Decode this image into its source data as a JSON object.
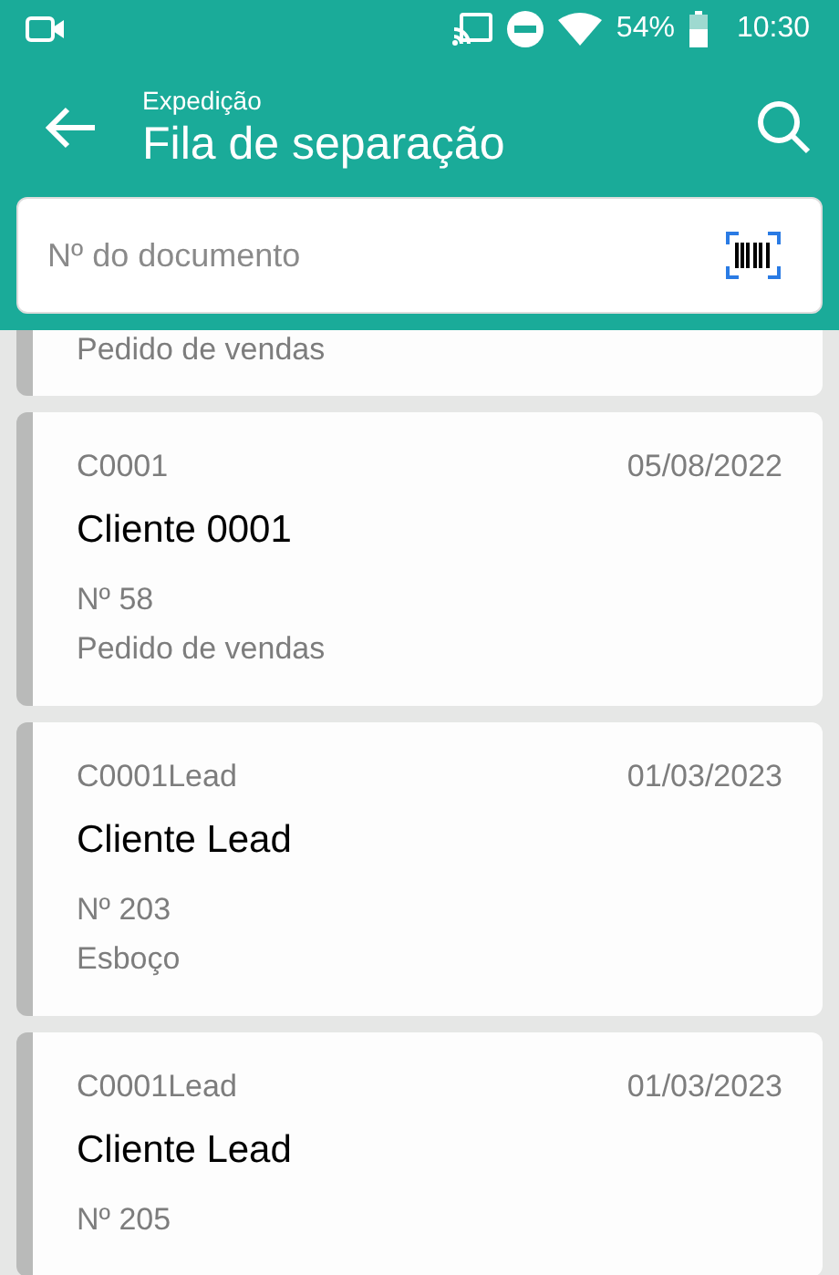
{
  "status_bar": {
    "battery": "54%",
    "time": "10:30"
  },
  "header": {
    "subtitle": "Expedição",
    "title": "Fila de separação"
  },
  "search": {
    "placeholder": "Nº do documento"
  },
  "orders": [
    {
      "kind": "partial",
      "status": "Pedido de vendas"
    },
    {
      "kind": "full",
      "code": "C0001",
      "date": "05/08/2022",
      "client": "Cliente 0001",
      "number": "Nº 58",
      "status": "Pedido de vendas"
    },
    {
      "kind": "full",
      "code": "C0001Lead",
      "date": "01/03/2023",
      "client": "Cliente Lead",
      "number": "Nº 203",
      "status": "Esboço"
    },
    {
      "kind": "full",
      "code": "C0001Lead",
      "date": "01/03/2023",
      "client": "Cliente Lead",
      "number": "Nº 205"
    }
  ]
}
